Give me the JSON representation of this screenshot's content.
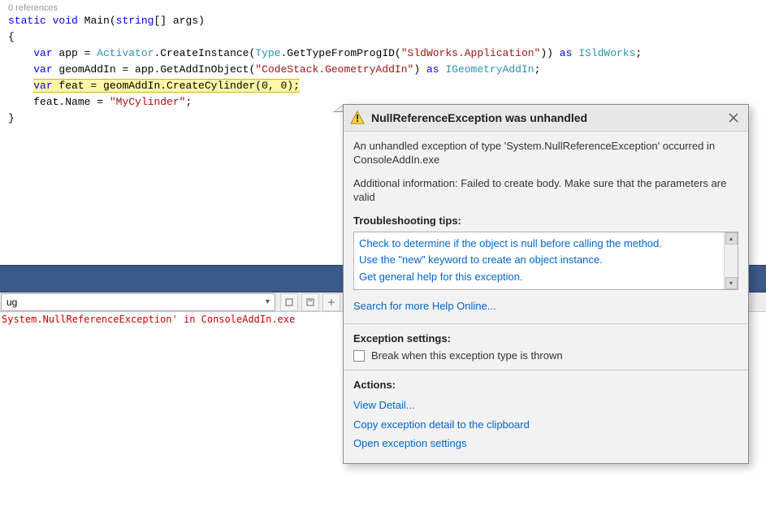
{
  "editor": {
    "references_label": "0 references",
    "code": {
      "sig_static": "static",
      "sig_void": "void",
      "sig_main": " Main(",
      "sig_string": "string",
      "sig_rest": "[] args)",
      "brace_open": "{",
      "l1_var": "var",
      "l1_a": " app = ",
      "l1_activator": "Activator",
      "l1_b": ".CreateInstance(",
      "l1_type": "Type",
      "l1_c": ".GetTypeFromProgID(",
      "l1_str": "\"SldWorks.Application\"",
      "l1_d": ")) ",
      "l1_as": "as",
      "l1_e": " ",
      "l1_isw": "ISldWorks",
      "l1_f": ";",
      "l2_var": "var",
      "l2_a": " geomAddIn = app.GetAddInObject(",
      "l2_str": "\"CodeStack.GeometryAddIn\"",
      "l2_b": ") ",
      "l2_as": "as",
      "l2_c": " ",
      "l2_iga": "IGeometryAddIn",
      "l2_d": ";",
      "l3_var": "var",
      "l3_a": " feat = geomAddIn.CreateCylinder(0, 0);",
      "l4_a": "feat.Name = ",
      "l4_str": "\"MyCylinder\"",
      "l4_b": ";",
      "brace_close": "}"
    }
  },
  "dropdown_value": "ug",
  "output_error": "System.NullReferenceException' in ConsoleAddIn.exe",
  "popup": {
    "title": "NullReferenceException was unhandled",
    "desc": "An unhandled exception of type 'System.NullReferenceException' occurred in ConsoleAddIn.exe",
    "additional": "Additional information: Failed to create body. Make sure that the parameters are valid",
    "tips_label": "Troubleshooting tips:",
    "tips": {
      "t1": "Check to determine if the object is null before calling the method.",
      "t2": "Use the \"new\" keyword to create an object instance.",
      "t3": "Get general help for this exception."
    },
    "search_link": "Search for more Help Online...",
    "settings_label": "Exception settings:",
    "break_label": "Break when this exception type is thrown",
    "actions_label": "Actions:",
    "action_view": "View Detail...",
    "action_copy": "Copy exception detail to the clipboard",
    "action_open": "Open exception settings"
  }
}
